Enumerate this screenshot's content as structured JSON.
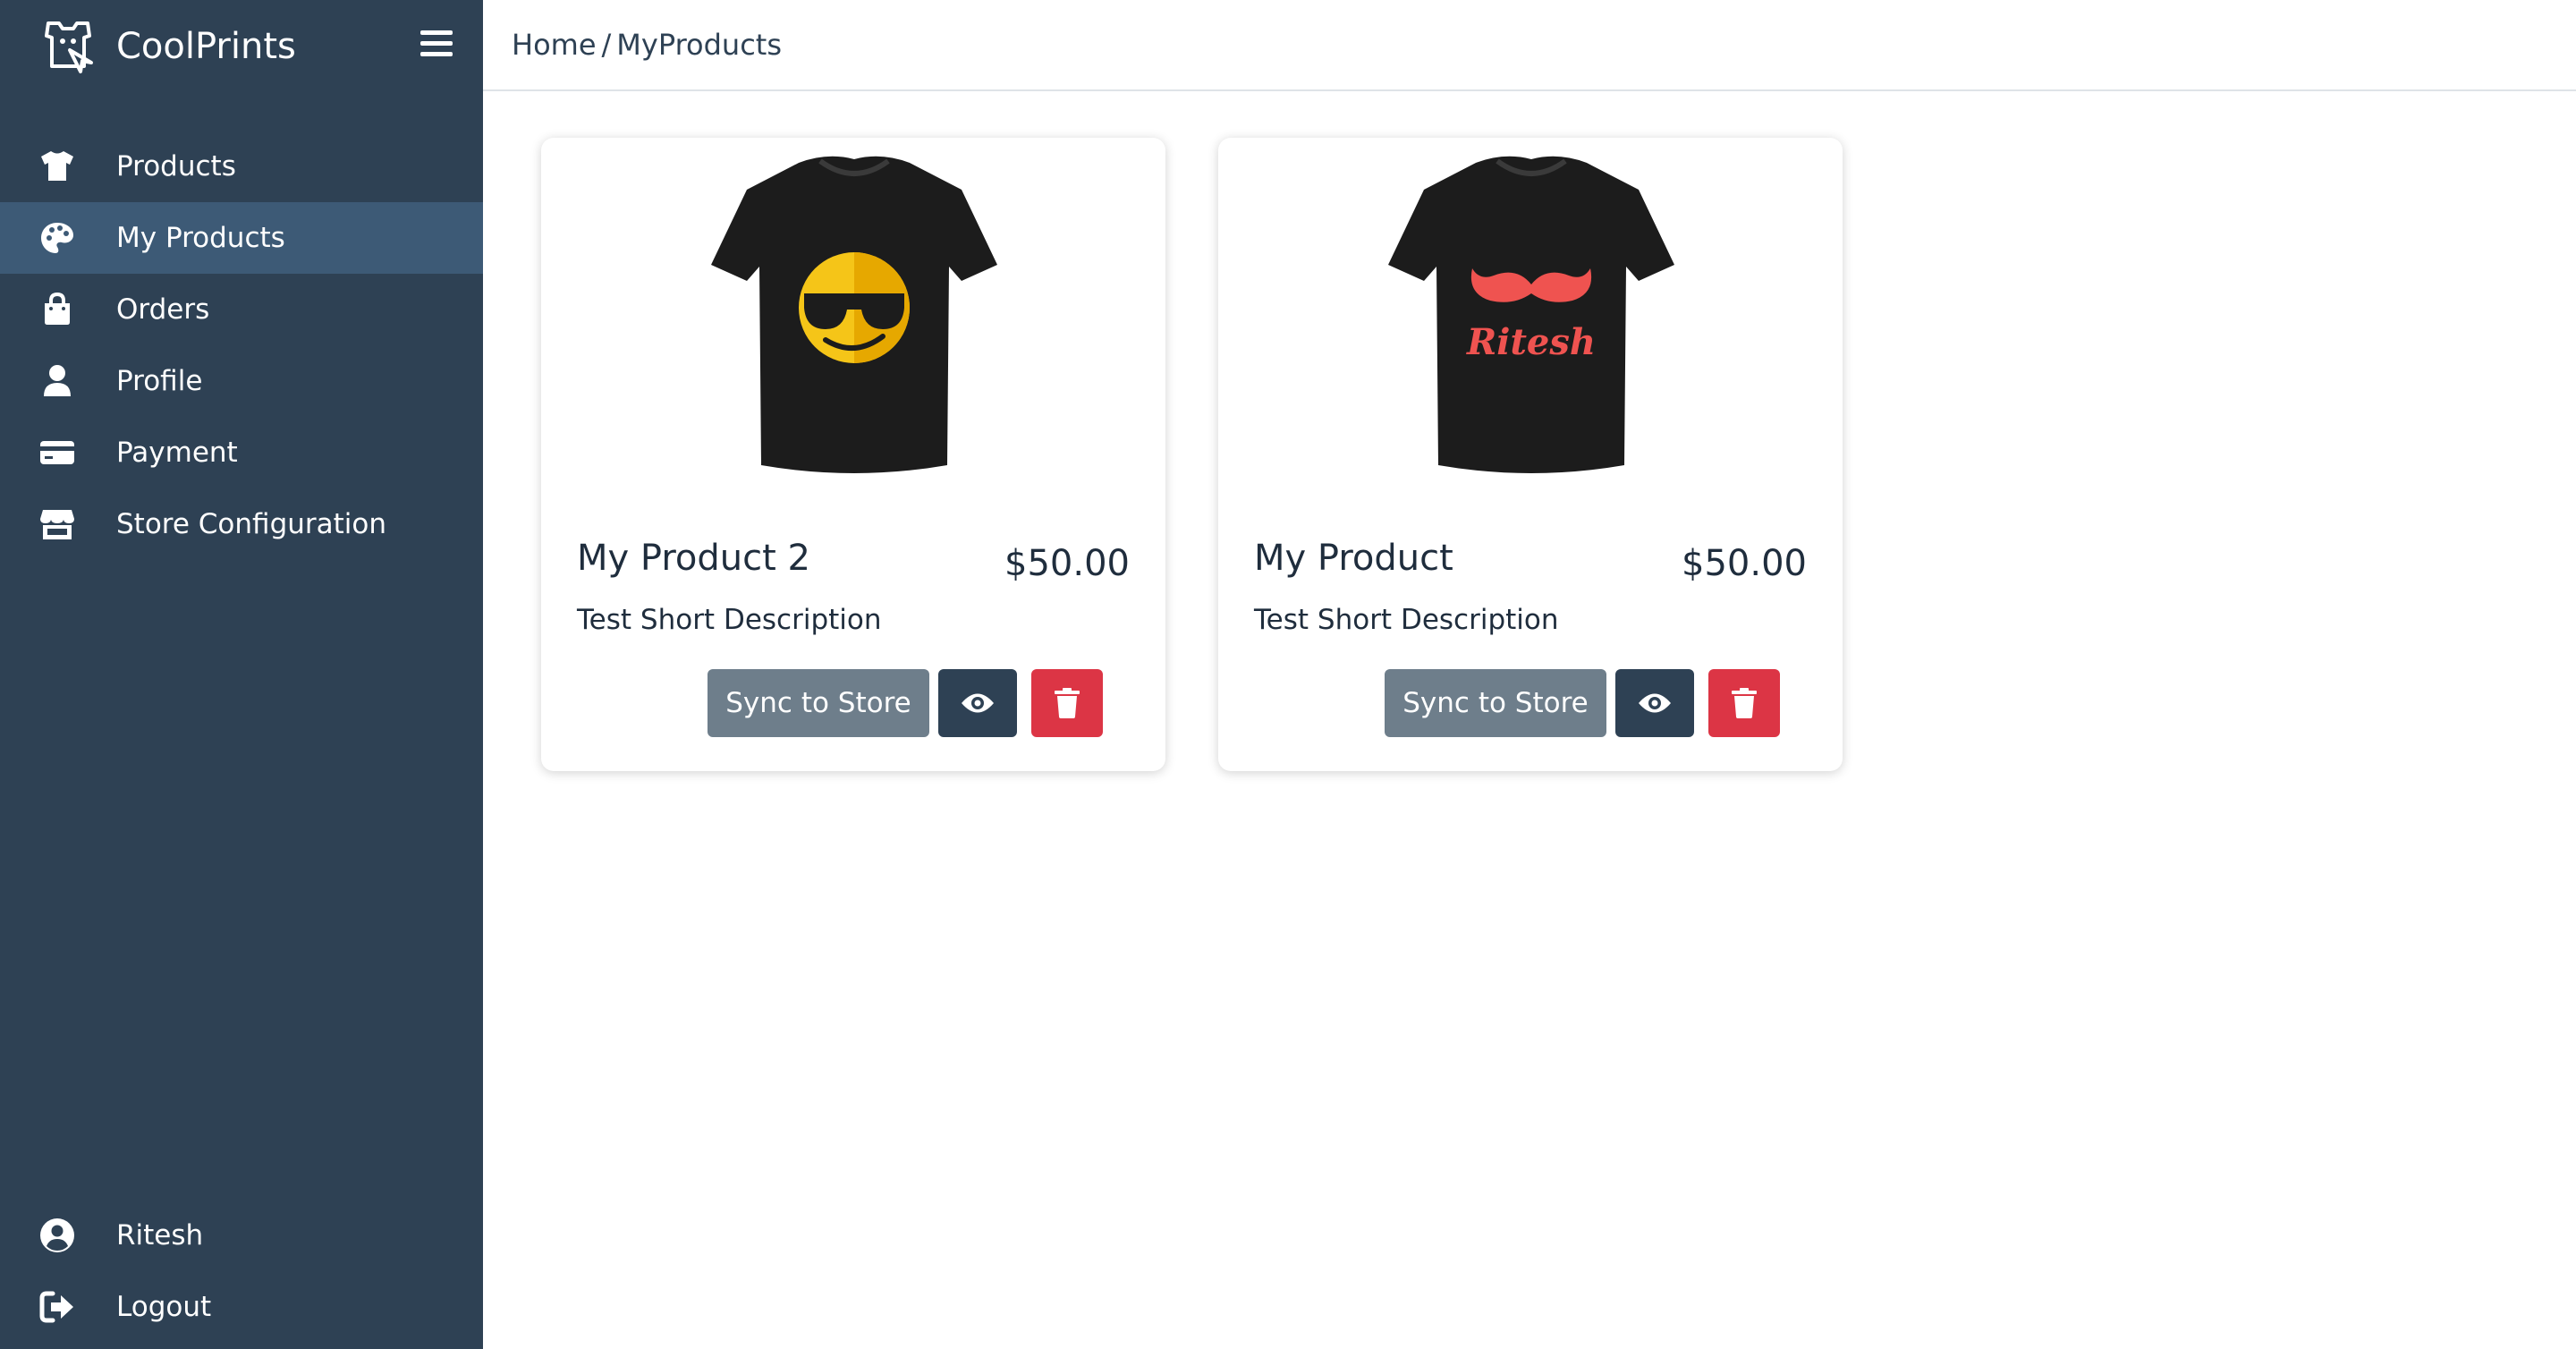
{
  "app": {
    "name": "CoolPrints"
  },
  "sidebar": {
    "items": [
      {
        "label": "Products",
        "icon": "tshirt-icon"
      },
      {
        "label": "My Products",
        "icon": "palette-icon",
        "active": true
      },
      {
        "label": "Orders",
        "icon": "shopping-bag-icon"
      },
      {
        "label": "Profile",
        "icon": "user-icon"
      },
      {
        "label": "Payment",
        "icon": "credit-card-icon"
      },
      {
        "label": "Store Configuration",
        "icon": "store-icon"
      }
    ],
    "bottom_items": [
      {
        "label": "Ritesh",
        "icon": "user-circle-icon"
      },
      {
        "label": "Logout",
        "icon": "sign-out-icon"
      }
    ]
  },
  "breadcrumb": {
    "home": "Home",
    "separator": "/",
    "current": "MyProducts"
  },
  "products": [
    {
      "title": "My Product 2",
      "price": "$50.00",
      "description": "Test Short Description",
      "sync_label": "Sync to Store",
      "design": "sunglasses-smiley"
    },
    {
      "title": "My Product",
      "price": "$50.00",
      "description": "Test Short Description",
      "sync_label": "Sync to Store",
      "design": "mustache",
      "design_text": "Ritesh"
    }
  ],
  "colors": {
    "sidebar_bg": "#2e4154",
    "sidebar_active": "#3d5a76",
    "sync_button": "#6e7e8b",
    "view_button": "#2e4154",
    "delete_button": "#dc3545"
  }
}
